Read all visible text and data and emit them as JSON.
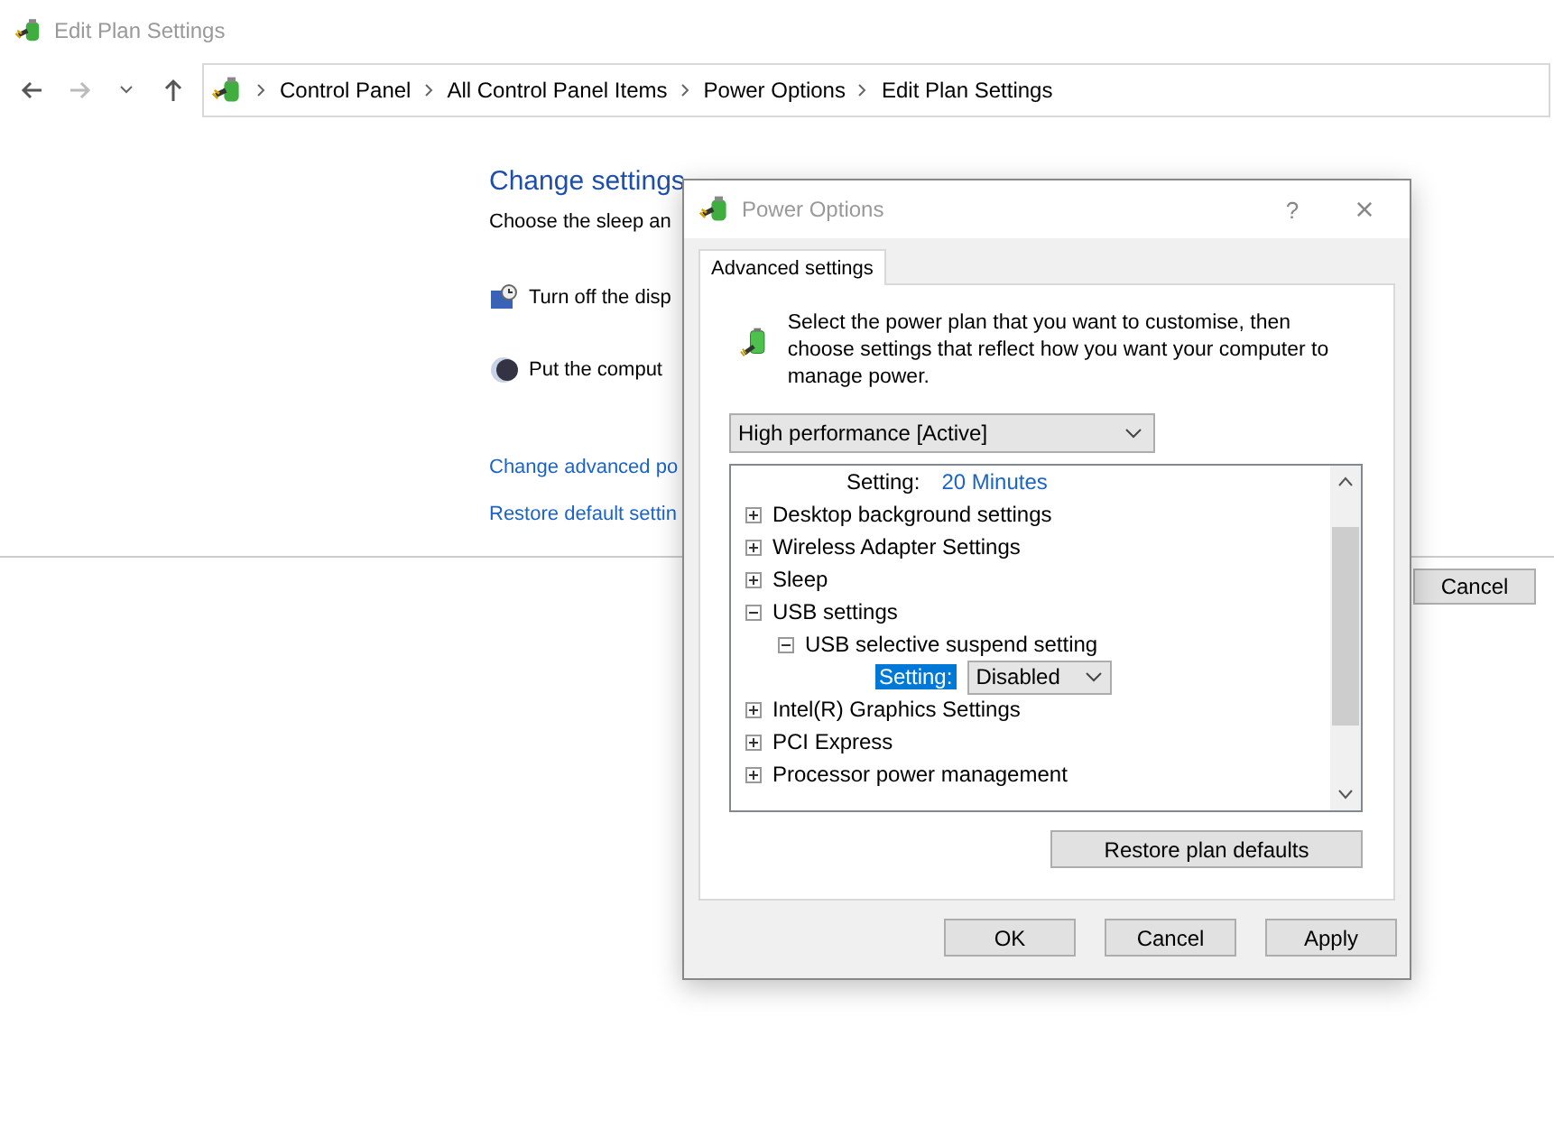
{
  "window": {
    "title": "Edit Plan Settings"
  },
  "breadcrumb": [
    "Control Panel",
    "All Control Panel Items",
    "Power Options",
    "Edit Plan Settings"
  ],
  "page": {
    "heading": "Change settings",
    "subtitle": "Choose the sleep an",
    "settings": [
      {
        "kind": "display",
        "label": "Turn off the disp"
      },
      {
        "kind": "sleep",
        "label": "Put the comput"
      }
    ],
    "links": [
      "Change advanced po",
      "Restore default settin"
    ],
    "cancel": "Cancel"
  },
  "dialog": {
    "title": "Power Options",
    "help": "?",
    "close": "×",
    "tabs": [
      {
        "label": "Advanced settings",
        "selected": true
      }
    ],
    "intro": "Select the power plan that you want to customise, then choose settings that reflect how you want your computer to manage power.",
    "plan": "High performance [Active]",
    "tree": [
      {
        "kind": "setting",
        "label": "Setting:",
        "value": "20 Minutes",
        "selected": false
      },
      {
        "kind": "group",
        "label": "Desktop background settings",
        "expanded": false
      },
      {
        "kind": "group",
        "label": "Wireless Adapter Settings",
        "expanded": false
      },
      {
        "kind": "group",
        "label": "Sleep",
        "expanded": false
      },
      {
        "kind": "group",
        "label": "USB settings",
        "expanded": true,
        "children": [
          {
            "kind": "group",
            "label": "USB selective suspend setting",
            "expanded": true,
            "children": [
              {
                "kind": "setting",
                "label": "Setting:",
                "value": "Disabled",
                "selected": true
              }
            ]
          }
        ]
      },
      {
        "kind": "group",
        "label": "Intel(R) Graphics Settings",
        "expanded": false
      },
      {
        "kind": "group",
        "label": "PCI Express",
        "expanded": false
      },
      {
        "kind": "group",
        "label": "Processor power management",
        "expanded": false
      }
    ],
    "restore": "Restore plan defaults",
    "buttons": [
      "OK",
      "Cancel",
      "Apply"
    ]
  }
}
